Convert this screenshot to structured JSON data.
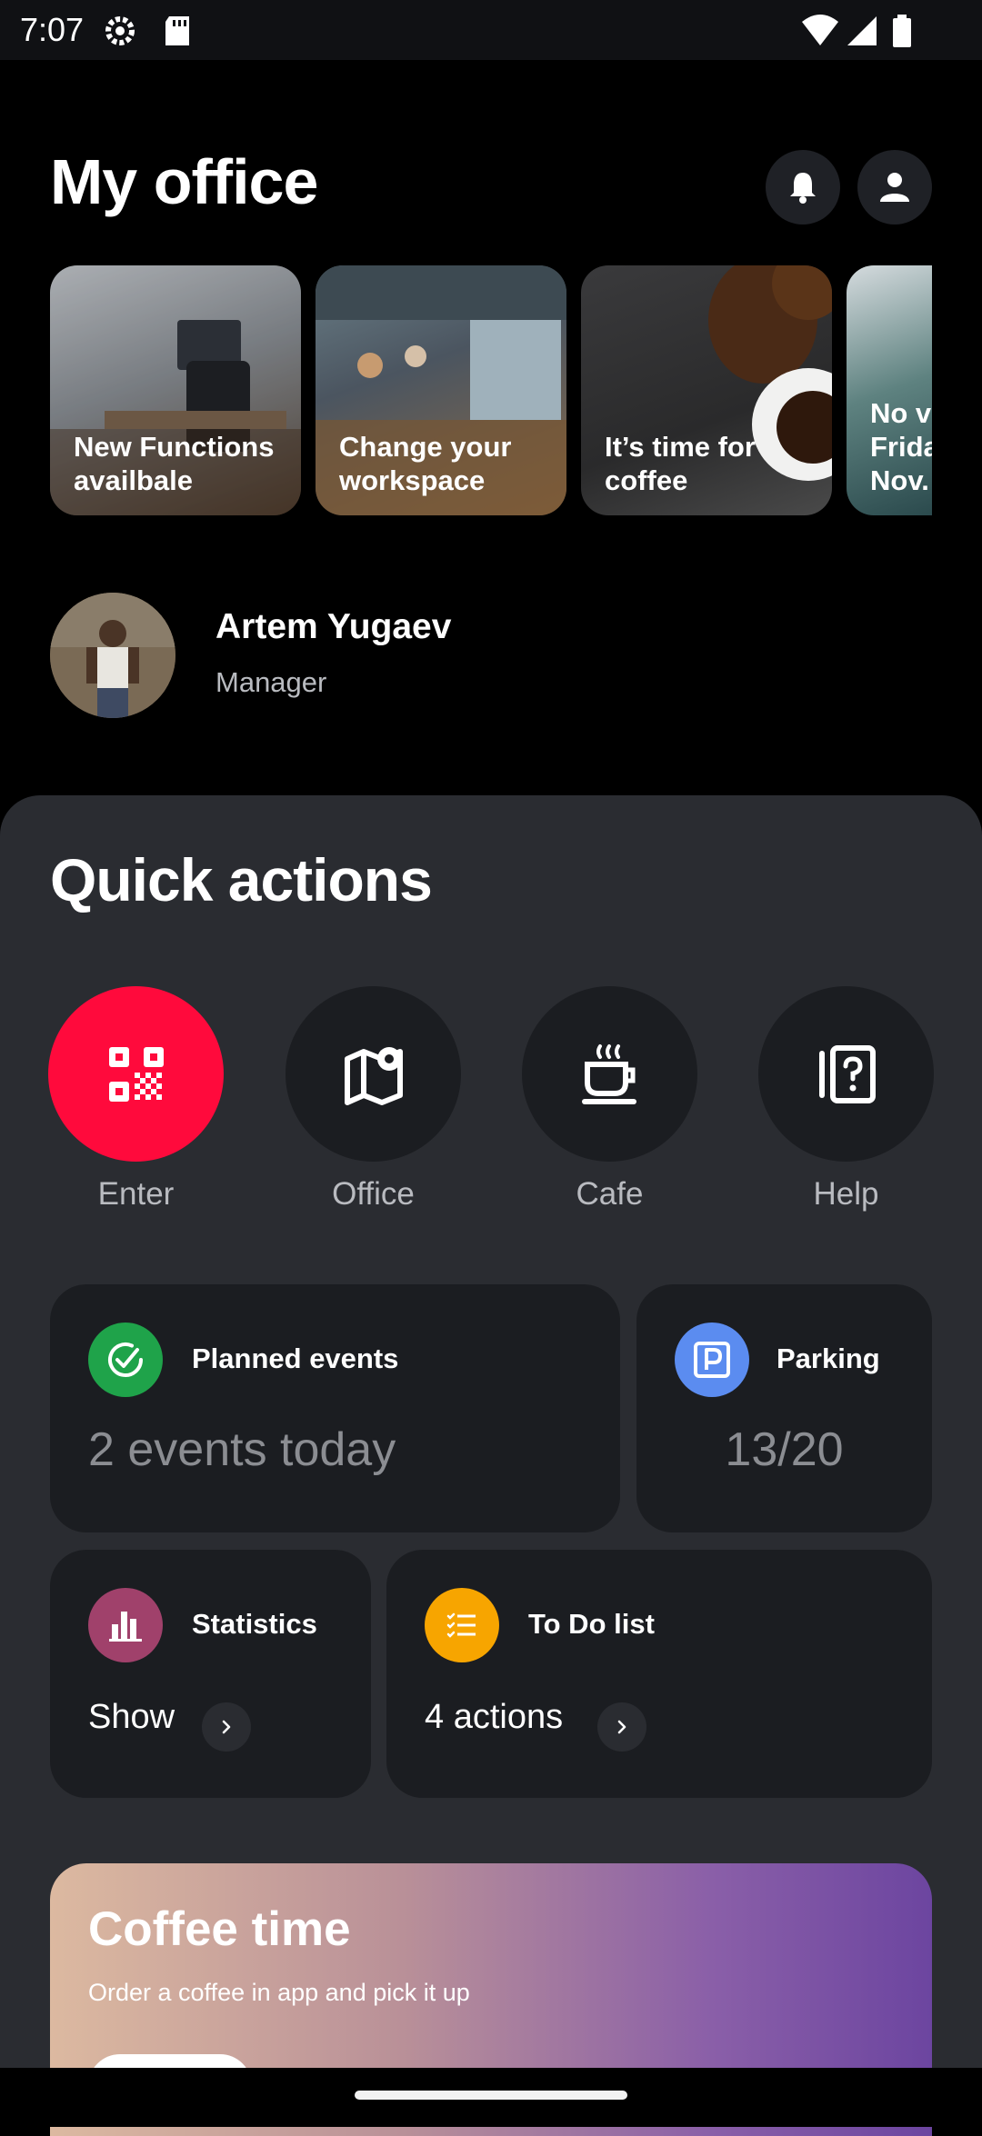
{
  "status_bar": {
    "time": "7:07"
  },
  "header": {
    "title": "My office"
  },
  "stories": [
    {
      "label": "New Functions availbale"
    },
    {
      "label": "Change your workspace"
    },
    {
      "label": "It’s time for coffee"
    },
    {
      "label": "No v... Frida... Nov..."
    }
  ],
  "profile": {
    "name": "Artem Yugaev",
    "role": "Manager"
  },
  "quick_actions": {
    "title": "Quick actions",
    "items": [
      {
        "label": "Enter",
        "icon": "qr-code-icon",
        "color": "#ff0a3c"
      },
      {
        "label": "Office",
        "icon": "map-pin-icon",
        "color": "#1b1d21"
      },
      {
        "label": "Cafe",
        "icon": "coffee-cup-icon",
        "color": "#1b1d21"
      },
      {
        "label": "Help",
        "icon": "help-book-icon",
        "color": "#1b1d21"
      }
    ]
  },
  "cards": {
    "planned_events": {
      "title": "Planned events",
      "value": "2 events today",
      "icon": "check-clock-icon",
      "color": "#1fa34a"
    },
    "parking": {
      "title": "Parking",
      "value": "13/20",
      "icon": "parking-icon",
      "color": "#5b8cf0"
    },
    "statistics": {
      "title": "Statistics",
      "link": "Show",
      "icon": "bar-chart-icon",
      "color": "#a0416b"
    },
    "todo": {
      "title": "To Do list",
      "link": "4 actions",
      "icon": "list-icon",
      "color": "#f7a500"
    }
  },
  "coffee": {
    "title": "Coffee time",
    "subtitle": "Order a coffee in app and pick it up"
  }
}
